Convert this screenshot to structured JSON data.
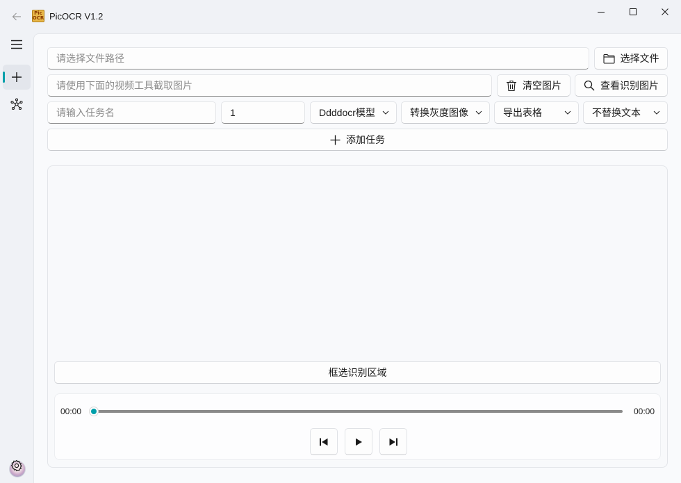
{
  "app": {
    "title": "PicOCR V1.2",
    "logo_top": "Pic",
    "logo_bottom": "OCR"
  },
  "window_controls": [
    "minimize-icon",
    "maximize-icon",
    "close-icon"
  ],
  "nav": {
    "items": [
      {
        "name": "menu",
        "icon": "hamburger-icon"
      },
      {
        "name": "add-task",
        "icon": "plus-icon",
        "active": true
      },
      {
        "name": "network",
        "icon": "network-icon"
      }
    ],
    "bottom": [
      {
        "name": "avatar"
      },
      {
        "name": "settings",
        "icon": "gear-icon"
      }
    ]
  },
  "file_path": {
    "placeholder": "请选择文件路径",
    "value": ""
  },
  "select_file_button": {
    "label": "选择文件",
    "icon": "folder-icon"
  },
  "image_path": {
    "placeholder": "请使用下面的视频工具截取图片",
    "value": ""
  },
  "clear_images_button": {
    "label": "清空图片",
    "icon": "trash-icon"
  },
  "view_images_button": {
    "label": "查看识别图片",
    "icon": "search-icon"
  },
  "task_name": {
    "placeholder": "请输入任务名",
    "value": ""
  },
  "task_count": {
    "value": "1"
  },
  "options": {
    "model": "Ddddocr模型",
    "grayscale": "转换灰度图像",
    "export": "导出表格",
    "replace": "不替换文本"
  },
  "add_task_button": {
    "label": "添加任务",
    "icon": "plus-icon"
  },
  "select_region_button": {
    "label": "框选识别区域"
  },
  "player": {
    "current_time": "00:00",
    "total_time": "00:00",
    "progress": 0,
    "accent": "#009faa",
    "controls": [
      "skip-back-icon",
      "play-icon",
      "skip-forward-icon"
    ]
  }
}
